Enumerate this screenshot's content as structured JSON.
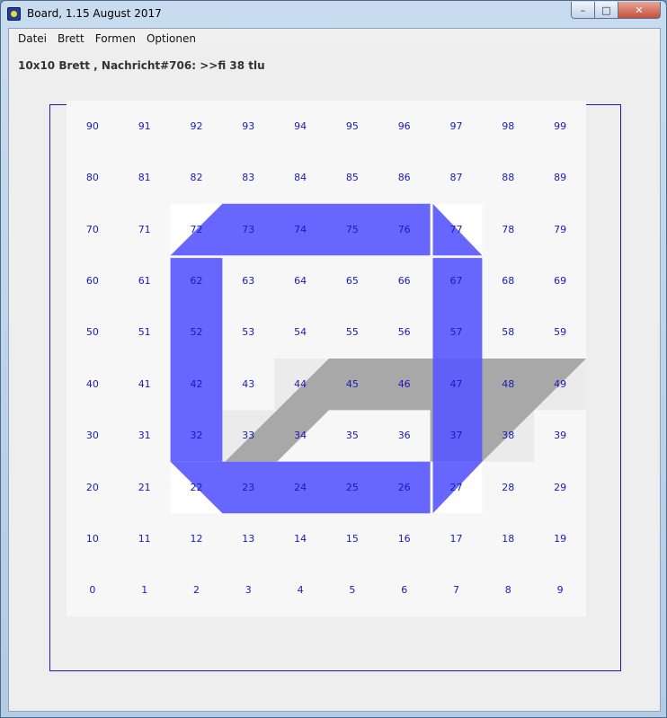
{
  "window": {
    "title": "Board, 1.15 August 2017",
    "buttons": {
      "minimize": "–",
      "maximize": "□",
      "close": "✕"
    }
  },
  "menu": [
    "Datei",
    "Brett",
    "Formen",
    "Optionen"
  ],
  "status_text": "10x10 Brett , Nachricht#706: >>fi 38 tlu",
  "board": {
    "rows": 10,
    "cols": 10,
    "colors": {
      "background": "#f7f7f7",
      "highlight_cell": "#ffffff",
      "shade_cell": "#ebebeb",
      "gray_shape": "#a8a8a8",
      "blue_shape": "#5a5aff",
      "number": "#1a1ab8",
      "frame": "#1a1ac0"
    },
    "white_cells": [
      72,
      77,
      22,
      27
    ],
    "light_gray_cells": [
      33,
      44,
      48,
      49,
      38
    ],
    "gray_parallelogram_cells": [
      33,
      34,
      44,
      45,
      46,
      47,
      48,
      49,
      37,
      38
    ],
    "blue_ring_cells": [
      72,
      73,
      74,
      75,
      76,
      77,
      62,
      67,
      52,
      57,
      42,
      47,
      32,
      37,
      22,
      23,
      24,
      25,
      26,
      27
    ]
  }
}
